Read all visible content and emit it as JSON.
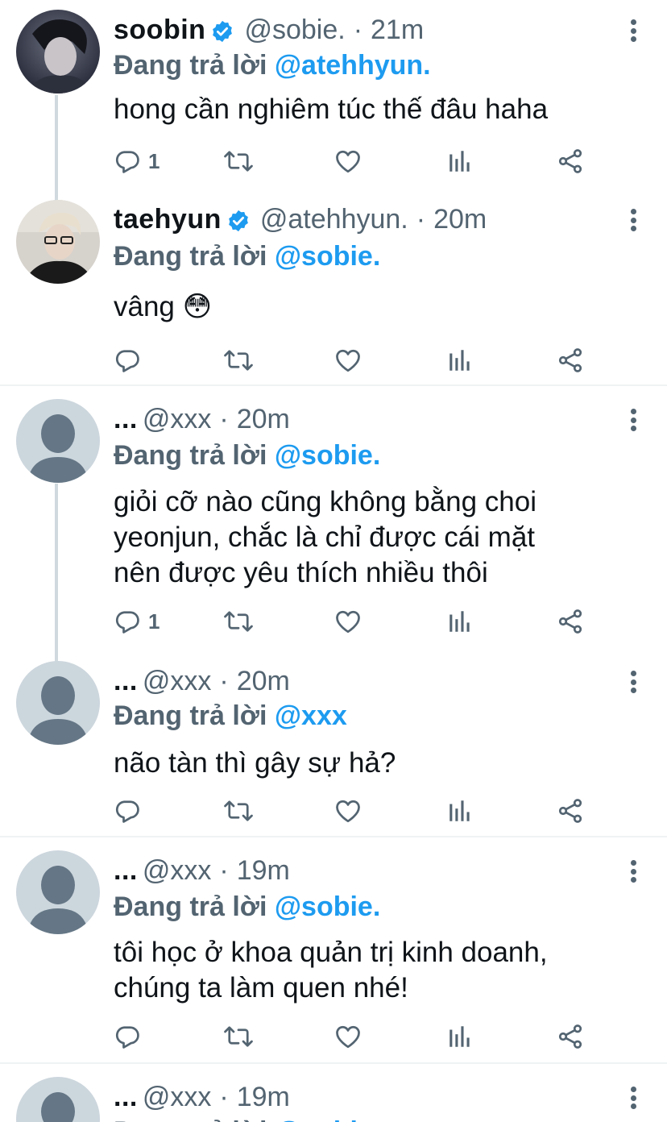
{
  "replying_label": "Đang trả lời",
  "tweets": [
    {
      "name": "soobin",
      "verified": true,
      "handle": "@sobie.",
      "time": "21m",
      "reply_to": "@atehhyun.",
      "text": "hong cần nghiêm túc thế đâu haha",
      "reply_count": "1",
      "avatar": "soobin-photo"
    },
    {
      "name": "taehyun",
      "verified": true,
      "handle": "@atehhyun.",
      "time": "20m",
      "reply_to": "@sobie.",
      "text": "vâng 😳",
      "reply_count": "",
      "avatar": "taehyun-photo"
    },
    {
      "name": "...",
      "verified": false,
      "handle": "@xxx",
      "time": "20m",
      "reply_to": "@sobie.",
      "text": "giỏi cỡ nào cũng không bằng choi\nyeonjun, chắc là chỉ được cái mặt\nnên được yêu thích nhiều thôi",
      "reply_count": "1",
      "avatar": "default-avatar"
    },
    {
      "name": "...",
      "verified": false,
      "handle": "@xxx",
      "time": "20m",
      "reply_to": "@xxx",
      "text": "não tàn thì gây sự hả?",
      "reply_count": "",
      "avatar": "default-avatar"
    },
    {
      "name": "...",
      "verified": false,
      "handle": "@xxx",
      "time": "19m",
      "reply_to": "@sobie.",
      "text": "tôi học ở khoa quản trị kinh doanh,\nchúng ta làm quen nhé!",
      "reply_count": "",
      "avatar": "default-avatar"
    },
    {
      "name": "...",
      "verified": false,
      "handle": "@xxx",
      "time": "19m",
      "reply_to": "@sobie.",
      "text": "",
      "reply_count": "",
      "avatar": "default-avatar"
    }
  ],
  "colors": {
    "link": "#1d9bf0",
    "secondary": "#536471",
    "primary_text": "#0f1419",
    "divider": "#eff3f4",
    "thread_line": "#cfd9de",
    "default_avatar_bg": "#ccd6dd",
    "default_avatar_fg": "#657786"
  }
}
